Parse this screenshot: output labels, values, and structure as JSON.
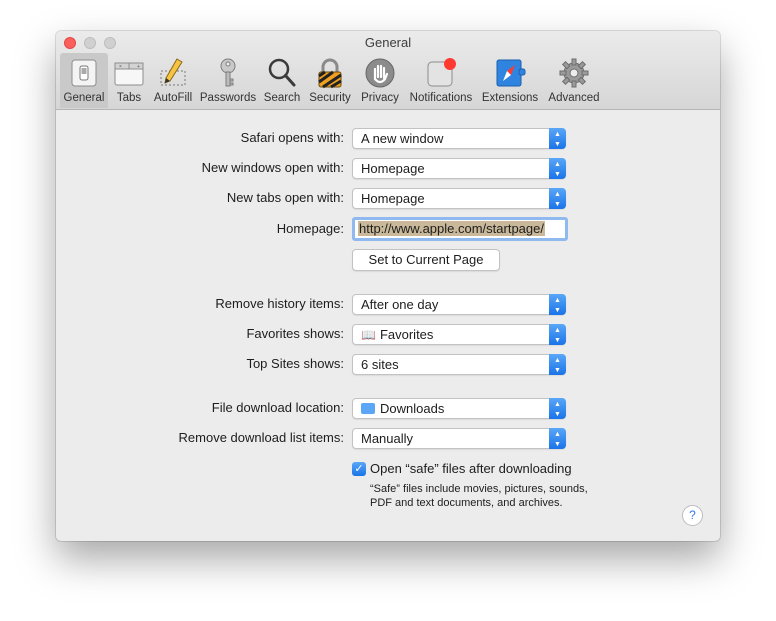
{
  "window": {
    "title": "General"
  },
  "toolbar": {
    "tabs": [
      {
        "label": "General",
        "icon": "general-switch-icon",
        "selected": true
      },
      {
        "label": "Tabs",
        "icon": "tabs-icon"
      },
      {
        "label": "AutoFill",
        "icon": "autofill-pencil-icon"
      },
      {
        "label": "Passwords",
        "icon": "key-icon"
      },
      {
        "label": "Search",
        "icon": "magnifier-icon"
      },
      {
        "label": "Security",
        "icon": "padlock-icon"
      },
      {
        "label": "Privacy",
        "icon": "hand-icon"
      },
      {
        "label": "Notifications",
        "icon": "notification-badge-icon"
      },
      {
        "label": "Extensions",
        "icon": "compass-icon"
      },
      {
        "label": "Advanced",
        "icon": "gear-icon"
      }
    ]
  },
  "settings": {
    "safari_opens_with": {
      "label": "Safari opens with:",
      "value": "A new window"
    },
    "new_windows": {
      "label": "New windows open with:",
      "value": "Homepage"
    },
    "new_tabs": {
      "label": "New tabs open with:",
      "value": "Homepage"
    },
    "homepage": {
      "label": "Homepage:",
      "value": "http://www.apple.com/startpage/"
    },
    "set_current_page": {
      "label": "Set to Current Page"
    },
    "remove_history": {
      "label": "Remove history items:",
      "value": "After one day"
    },
    "favorites_shows": {
      "label": "Favorites shows:",
      "value": "Favorites",
      "icon": "book-icon"
    },
    "top_sites": {
      "label": "Top Sites shows:",
      "value": "6 sites"
    },
    "download_location": {
      "label": "File download location:",
      "value": "Downloads",
      "icon": "folder-icon"
    },
    "remove_download": {
      "label": "Remove download list items:",
      "value": "Manually"
    },
    "open_safe_files": {
      "label": "Open “safe” files after downloading",
      "checked": true,
      "note": "“Safe” files include movies, pictures, sounds, PDF and text documents, and archives."
    }
  },
  "help": {
    "label": "?"
  },
  "colors": {
    "accent": "#1a74e8",
    "close": "#fc605c",
    "selection": "#c9b99a",
    "notification_badge": "#ff3b30"
  }
}
